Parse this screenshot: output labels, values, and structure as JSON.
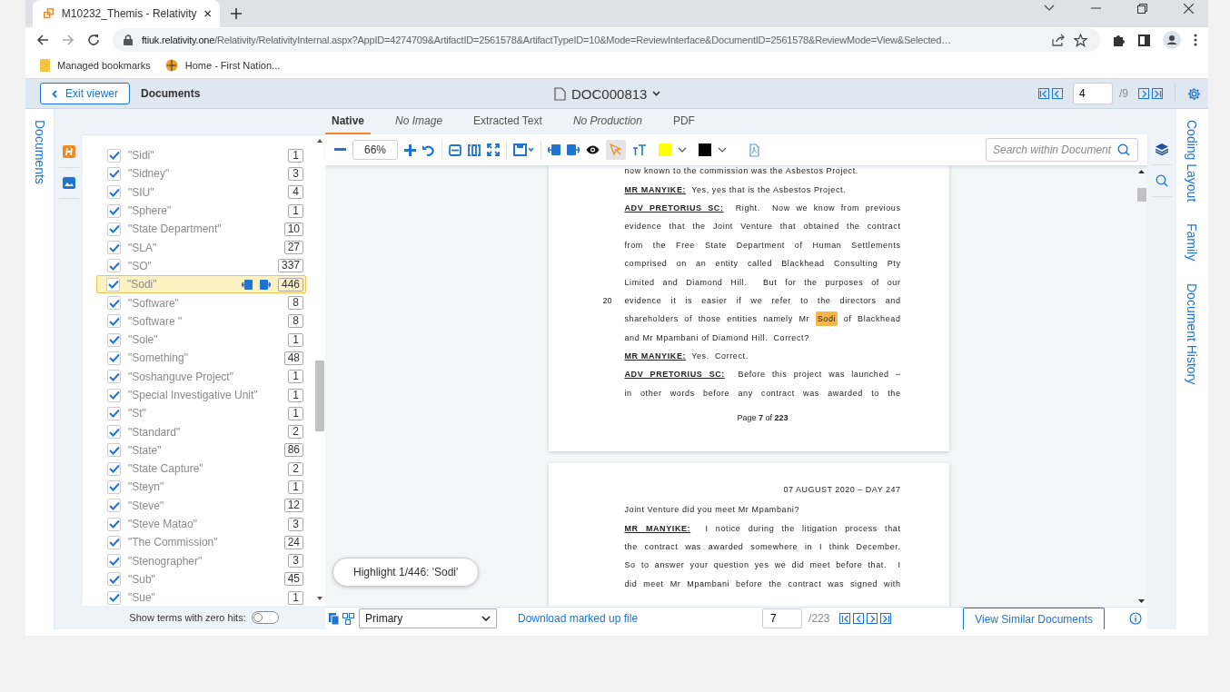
{
  "browser": {
    "tab_title": "M10232_Themis - Relativity",
    "url_host": "ftiuk.relativity.one",
    "url_path": "/Relativity/RelativityInternal.aspx?AppID=4274709&ArtifactID=2561578&ArtifactTypeID=10&Mode=ReviewInterface&DocumentID=2561578&ReviewMode=View&Selected…",
    "bookmarks": [
      {
        "label": "Managed bookmarks",
        "kind": "folder"
      },
      {
        "label": "Home - First Nation...",
        "kind": "site"
      }
    ]
  },
  "header": {
    "exit_button": "Exit viewer",
    "section": "Documents",
    "document_title": "DOC000813",
    "page_field": "4",
    "page_total": "/9"
  },
  "left_tabs": [
    "Documents"
  ],
  "terms": [
    {
      "label": "\"Sidi\"",
      "count": "1",
      "checked": true,
      "selected": false
    },
    {
      "label": "\"Sidney\"",
      "count": "3",
      "checked": true,
      "selected": false
    },
    {
      "label": "\"SIU\"",
      "count": "4",
      "checked": true,
      "selected": false
    },
    {
      "label": "\"Sphere\"",
      "count": "1",
      "checked": true,
      "selected": false
    },
    {
      "label": "\"State Department\"",
      "count": "10",
      "checked": true,
      "selected": false
    },
    {
      "label": "\"SLA\"",
      "count": "27",
      "checked": true,
      "selected": false
    },
    {
      "label": "\"SO\"",
      "count": "337",
      "checked": true,
      "selected": false
    },
    {
      "label": "\"Sodi\"",
      "count": "446",
      "checked": true,
      "selected": true
    },
    {
      "label": "\"Software\"",
      "count": "8",
      "checked": true,
      "selected": false
    },
    {
      "label": "\"Software \"",
      "count": "8",
      "checked": true,
      "selected": false
    },
    {
      "label": "\"Sole\"",
      "count": "1",
      "checked": true,
      "selected": false
    },
    {
      "label": "\"Something\"",
      "count": "48",
      "checked": true,
      "selected": false
    },
    {
      "label": "\"Soshanguve Project\"",
      "count": "1",
      "checked": true,
      "selected": false
    },
    {
      "label": "\"Special Investigative Unit\"",
      "count": "1",
      "checked": true,
      "selected": false
    },
    {
      "label": "\"St\"",
      "count": "1",
      "checked": true,
      "selected": false
    },
    {
      "label": "\"Standard\"",
      "count": "2",
      "checked": true,
      "selected": false
    },
    {
      "label": "\"State\"",
      "count": "86",
      "checked": true,
      "selected": false
    },
    {
      "label": "\"State Capture\"",
      "count": "2",
      "checked": true,
      "selected": false
    },
    {
      "label": "\"Steyn\"",
      "count": "1",
      "checked": true,
      "selected": false
    },
    {
      "label": "\"Steve\"",
      "count": "12",
      "checked": true,
      "selected": false
    },
    {
      "label": "\"Steve Matao\"",
      "count": "3",
      "checked": true,
      "selected": false
    },
    {
      "label": "\"The Commission\"",
      "count": "24",
      "checked": true,
      "selected": false
    },
    {
      "label": "\"Stenographer\"",
      "count": "3",
      "checked": true,
      "selected": false
    },
    {
      "label": "\"Sub\"",
      "count": "45",
      "checked": true,
      "selected": false
    },
    {
      "label": "\"Sue\"",
      "count": "1",
      "checked": true,
      "selected": false
    }
  ],
  "zero_hits_toggle": {
    "label": "Show terms with zero hits:",
    "on": false
  },
  "viewer_tabs": [
    {
      "label": "Native",
      "selected": true,
      "available": true
    },
    {
      "label": "No Image",
      "selected": false,
      "available": false
    },
    {
      "label": "Extracted Text",
      "selected": false,
      "available": true
    },
    {
      "label": "No Production",
      "selected": false,
      "available": false
    },
    {
      "label": "PDF",
      "selected": false,
      "available": true
    }
  ],
  "toolbar": {
    "zoom": "66%",
    "search_placeholder": "Search within Document"
  },
  "page_top": {
    "lines": [
      {
        "justify": false,
        "parts": [
          {
            "kind": "text",
            "text": "now known to the commission was the Asbestos Project."
          }
        ]
      },
      {
        "justify": false,
        "parts": [
          {
            "kind": "speaker",
            "text": "MR MANYIKE:"
          },
          {
            "kind": "text",
            "text": "  Yes, yes that is the Asbestos Project."
          }
        ]
      },
      {
        "justify": true,
        "parts": [
          {
            "kind": "speaker",
            "text": "ADV PRETORIUS SC:"
          },
          {
            "kind": "text",
            "text": "  Right.  Now we know from previous"
          }
        ]
      },
      {
        "justify": true,
        "parts": [
          {
            "kind": "text",
            "text": "evidence that the Joint Venture that obtained the contract"
          }
        ]
      },
      {
        "justify": true,
        "parts": [
          {
            "kind": "text",
            "text": "from the Free State Department of Human Settlements"
          }
        ]
      },
      {
        "justify": true,
        "parts": [
          {
            "kind": "text",
            "text": "comprised on an entity called Blackhead Consulting Pty"
          }
        ]
      },
      {
        "justify": true,
        "parts": [
          {
            "kind": "text",
            "text": "Limited and Diamond Hill.  But for the purposes of our"
          }
        ]
      },
      {
        "justify": true,
        "number": "20",
        "parts": [
          {
            "kind": "text",
            "text": "evidence it is easier if we refer to the directors and"
          }
        ]
      },
      {
        "justify": true,
        "parts": [
          {
            "kind": "text",
            "text": "shareholders of those entities namely Mr "
          },
          {
            "kind": "hit",
            "text": "Sodi"
          },
          {
            "kind": "text",
            "text": " of Blackhead"
          }
        ]
      },
      {
        "justify": false,
        "parts": [
          {
            "kind": "text",
            "text": "and Mr Mpambani of Diamond Hill.  Correct?"
          }
        ]
      },
      {
        "justify": false,
        "parts": [
          {
            "kind": "speaker",
            "text": "MR MANYIKE:"
          },
          {
            "kind": "text",
            "text": "  Yes.  Correct."
          }
        ]
      },
      {
        "justify": true,
        "parts": [
          {
            "kind": "speaker",
            "text": "ADV PRETORIUS SC:"
          },
          {
            "kind": "text",
            "text": "  Before this project was launched –"
          }
        ]
      },
      {
        "justify": true,
        "parts": [
          {
            "kind": "text",
            "text": "in other words before any contract was awarded to the"
          }
        ]
      }
    ],
    "footer": "Page **7** of **223**"
  },
  "page_next": {
    "header": "07 AUGUST 2020 – DAY 247",
    "lines": [
      {
        "justify": false,
        "parts": [
          {
            "kind": "text",
            "text": "Joint Venture did you meet Mr Mpambani?"
          }
        ]
      },
      {
        "justify": true,
        "parts": [
          {
            "kind": "speaker",
            "text": "MR MANYIKE:"
          },
          {
            "kind": "text",
            "text": "  I notice during the litigation process that"
          }
        ]
      },
      {
        "justify": true,
        "parts": [
          {
            "kind": "text",
            "text": "the contract was awarded somewhere in I think December."
          }
        ]
      },
      {
        "justify": true,
        "parts": [
          {
            "kind": "text",
            "text": "So to answer your question yes we did meet before that.  I"
          }
        ]
      },
      {
        "justify": true,
        "parts": [
          {
            "kind": "text",
            "text": "did meet Mr Mpambani before the contract was signed with"
          }
        ]
      }
    ]
  },
  "highlight_toast": "Highlight 1/446: 'Sodi'",
  "bottom_bar": {
    "layout_select": "Primary",
    "download_link": "Download marked up file",
    "page_field": "7",
    "page_total": "/223",
    "similar_button": "View Similar Documents"
  },
  "right_tabs": [
    "Coding Layout",
    "Family",
    "Document History"
  ]
}
